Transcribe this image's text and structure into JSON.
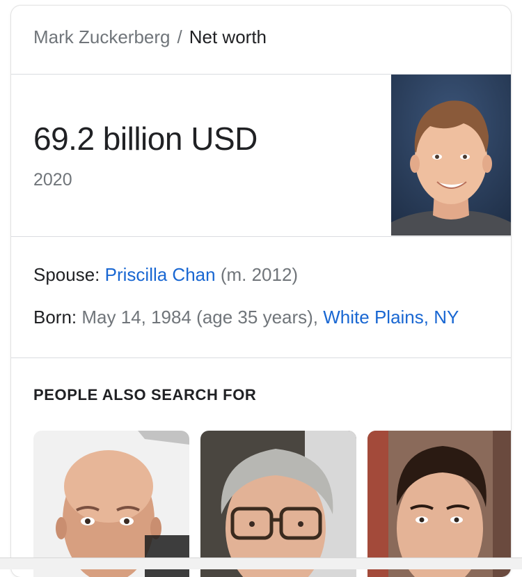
{
  "breadcrumb": {
    "parent": "Mark Zuckerberg",
    "separator": "/",
    "current": "Net worth"
  },
  "net_worth": {
    "value": "69.2 billion USD",
    "year": "2020"
  },
  "facts": {
    "spouse": {
      "label": "Spouse:",
      "name": "Priscilla Chan",
      "detail": "(m. 2012)"
    },
    "born": {
      "label": "Born:",
      "date": "May 14, 1984 (age 35 years),",
      "place": "White Plains, NY"
    }
  },
  "people_also_search": {
    "title": "PEOPLE ALSO SEARCH FOR"
  },
  "colors": {
    "link": "#1967d2",
    "muted_text": "#70757a",
    "primary_text": "#202124",
    "divider": "#dadce0"
  }
}
